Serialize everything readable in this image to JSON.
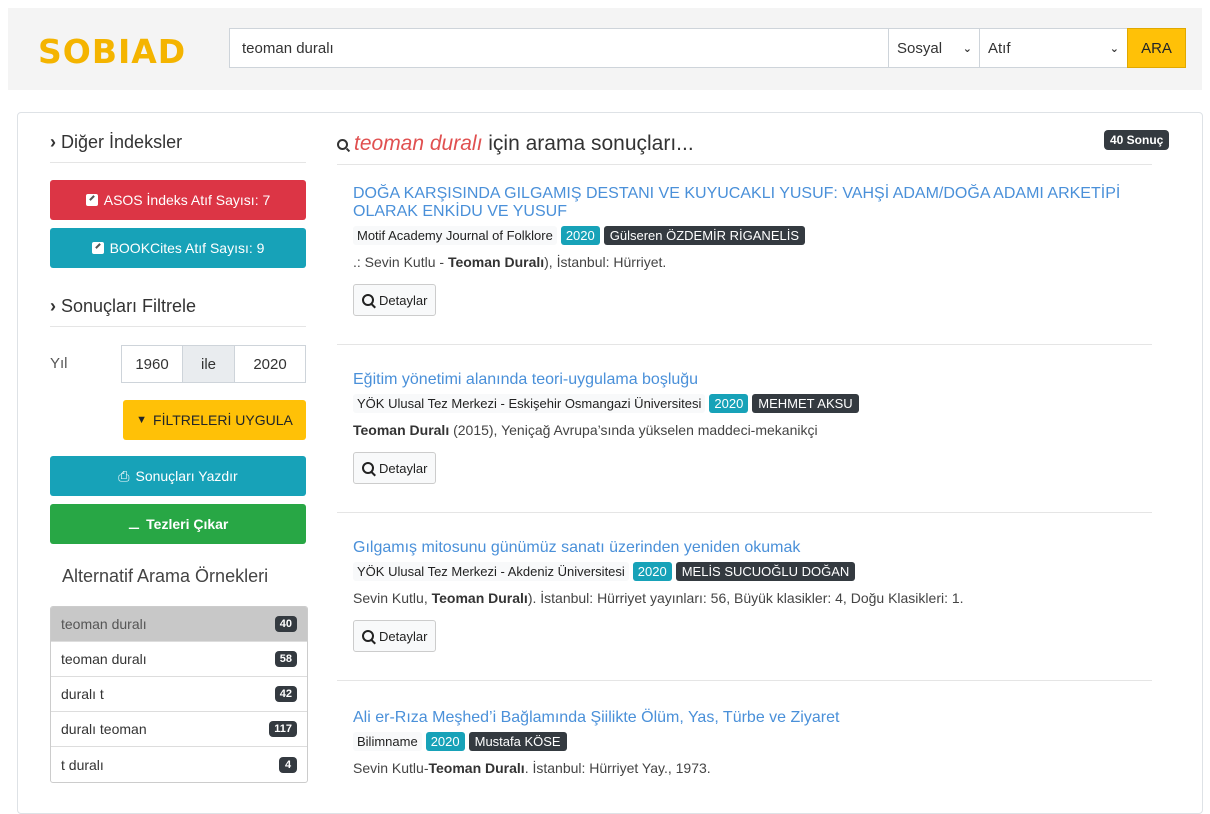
{
  "header": {
    "logo": "SOBIAD",
    "search_value": "teoman duralı",
    "select_field": "Sosyal",
    "select_type": "Atıf",
    "search_button": "ARA"
  },
  "sidebar": {
    "other_indexes_title": "Diğer İndeksler",
    "asos_button": "ASOS İndeks Atıf Sayısı: 7",
    "bookcites_button": "BOOKCites Atıf Sayısı: 9",
    "filter_title": "Sonuçları Filtrele",
    "year_label": "Yıl",
    "year_from": "1960",
    "year_sep": "ile",
    "year_to": "2020",
    "apply_filters": "FİLTRELERİ UYGULA",
    "print_results": "Sonuçları Yazdır",
    "extract_theses": "Tezleri Çıkar",
    "alt_title": "Alternatif Arama Örnekleri",
    "alt_items": [
      {
        "label": "teoman duralı",
        "count": "40"
      },
      {
        "label": "teoman duralı",
        "count": "58"
      },
      {
        "label": "duralı t",
        "count": "42"
      },
      {
        "label": "duralı teoman",
        "count": "117"
      },
      {
        "label": "t duralı",
        "count": "4"
      }
    ]
  },
  "results": {
    "query": "teoman duralı",
    "heading_suffix": " için arama sonuçları...",
    "count_badge": "40 Sonuç",
    "detail_label": "Detaylar",
    "items": [
      {
        "title": "DOĞA KARŞISINDA GILGAMIŞ DESTANI VE KUYUCAKLI YUSUF: VAHŞİ ADAM/DOĞA ADAMI ARKETİPİ OLARAK ENKİDU VE YUSUF",
        "source": "Motif Academy Journal of Folklore",
        "year": "2020",
        "author": "Gülseren ÖZDEMİR RİGANELİS",
        "snippet_pre": ".: Sevin Kutlu - ",
        "snippet_bold": "Teoman Duralı",
        "snippet_post": "), İstanbul: Hürriyet."
      },
      {
        "title": "Eğitim yönetimi alanında teori-uygulama boşluğu",
        "source": "YÖK Ulusal Tez Merkezi - Eskişehir Osmangazi Üniversitesi",
        "year": "2020",
        "author": "MEHMET AKSU",
        "snippet_pre": "",
        "snippet_bold": "Teoman Duralı",
        "snippet_post": " (2015), Yeniçağ Avrupa’sında yükselen maddeci-mekanikçi"
      },
      {
        "title": "Gılgamış mitosunu günümüz sanatı üzerinden yeniden okumak",
        "source": "YÖK Ulusal Tez Merkezi - Akdeniz Üniversitesi",
        "year": "2020",
        "author": "MELİS SUCUOĞLU DOĞAN",
        "snippet_pre": "Sevin Kutlu, ",
        "snippet_bold": "Teoman Duralı",
        "snippet_post": "). İstanbul: Hürriyet yayınları: 56, Büyük klasikler: 4, Doğu Klasikleri: 1."
      },
      {
        "title": "Ali er-Rıza Meşhed’i Bağlamında Şiilikte Ölüm, Yas, Türbe ve Ziyaret",
        "source": "Bilimname",
        "year": "2020",
        "author": "Mustafa KÖSE",
        "snippet_pre": "Sevin Kutlu-",
        "snippet_bold": "Teoman Duralı",
        "snippet_post": ". İstanbul: Hürriyet Yay., 1973."
      }
    ]
  }
}
